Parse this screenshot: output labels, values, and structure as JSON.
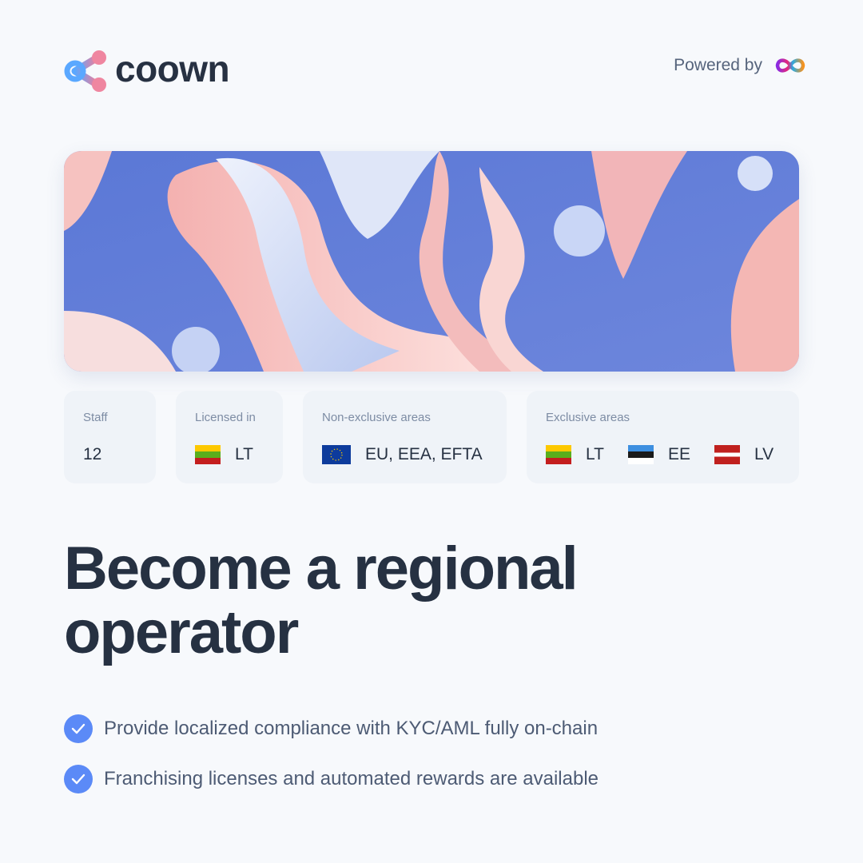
{
  "brand": {
    "name": "coown",
    "powered_by": "Powered by",
    "partner_logo_icon": "infinity-icon"
  },
  "stats": [
    {
      "label": "Staff",
      "value": "12"
    },
    {
      "label": "Licensed in",
      "value": "LT"
    },
    {
      "label": "Non-exclusive areas",
      "value": "EU, EEA, EFTA"
    },
    {
      "label": "Exclusive areas",
      "values": [
        "LT",
        "EE",
        "LV"
      ]
    }
  ],
  "heading": {
    "line1": "Become a regional",
    "line2": "operator"
  },
  "bullets": [
    "Provide localized compliance with KYC/AML fully on-chain",
    "Franchising licenses and automated rewards are available"
  ],
  "colors": {
    "accent": "#5b8af7",
    "text": "#263142",
    "background": "#f7f9fc"
  }
}
